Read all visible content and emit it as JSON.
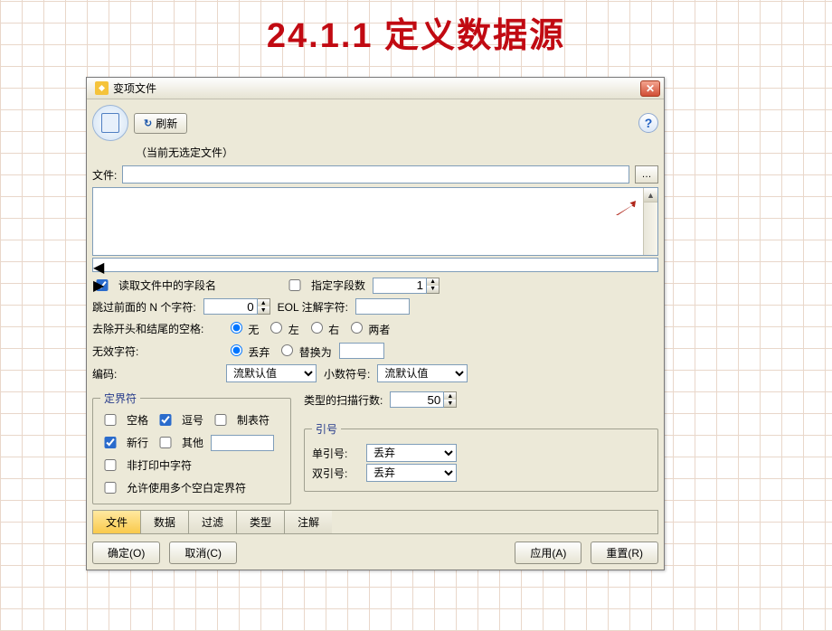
{
  "slide": {
    "title": "24.1.1 定义数据源"
  },
  "dialog": {
    "title": "变项文件",
    "refresh": "刷新",
    "help_glyph": "?",
    "no_file": "（当前无选定文件）",
    "file_label": "文件:",
    "file_value": "",
    "browse_glyph": "…",
    "read_field_names": "读取文件中的字段名",
    "specify_fields": "指定字段数",
    "specify_fields_value": "1",
    "skip_chars_label": "跳过前面的 N 个字符:",
    "skip_chars_value": "0",
    "eol_label": "EOL 注解字符:",
    "eol_value": "",
    "trim_label": "去除开头和结尾的空格:",
    "trim_options": [
      "无",
      "左",
      "右",
      "两者"
    ],
    "invalid_label": "无效字符:",
    "invalid_options": [
      "丢弃",
      "替换为"
    ],
    "invalid_replace_value": "",
    "encoding_label": "编码:",
    "encoding_value": "流默认值",
    "decimal_label": "小数符号:",
    "decimal_value": "流默认值",
    "delim_legend": "定界符",
    "delims": {
      "space": "空格",
      "comma": "逗号",
      "tab": "制表符",
      "newline": "新行",
      "other": "其他",
      "other_value": "",
      "nonprint": "非打印中字符",
      "multi": "允许使用多个空白定界符"
    },
    "scan_rows_label": "类型的扫描行数:",
    "scan_rows_value": "50",
    "quotes_legend": "引号",
    "single_quote_label": "单引号:",
    "single_quote_value": "丢弃",
    "double_quote_label": "双引号:",
    "double_quote_value": "丢弃",
    "tabs": [
      "文件",
      "数据",
      "过滤",
      "类型",
      "注解"
    ],
    "active_tab": 0,
    "ok": "确定(O)",
    "cancel": "取消(C)",
    "apply": "应用(A)",
    "reset": "重置(R)"
  }
}
